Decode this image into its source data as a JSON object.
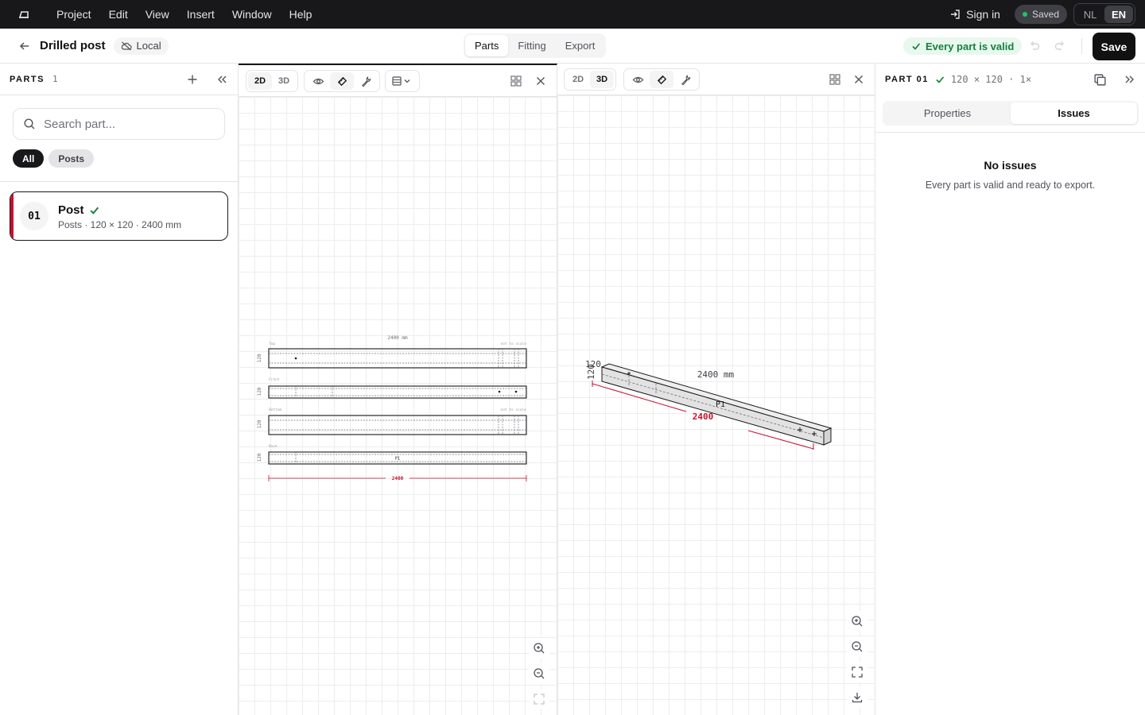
{
  "menubar": {
    "items": [
      "Project",
      "Edit",
      "View",
      "Insert",
      "Window",
      "Help"
    ],
    "sign_in": "Sign in",
    "saved": "Saved",
    "saved_color": "#22c55e",
    "languages": [
      "NL",
      "EN"
    ],
    "active_language": "EN"
  },
  "header": {
    "title": "Drilled post",
    "storage": "Local",
    "modes": [
      "Parts",
      "Fitting",
      "Export"
    ],
    "active_mode": "Parts",
    "status": "Every part is valid",
    "save": "Save"
  },
  "sidebar": {
    "title": "PARTS",
    "count": "1",
    "search_placeholder": "Search part...",
    "filters": [
      "All",
      "Posts"
    ],
    "active_filter": "All",
    "parts": [
      {
        "number": "01",
        "name": "Post",
        "meta": "Posts · 120 × 120 · 2400 mm",
        "valid": true,
        "color": "#c8102e"
      }
    ]
  },
  "view2d": {
    "modes": [
      "2D",
      "3D"
    ],
    "active": "2D",
    "length_label": "2400 mm",
    "dim_total": "2400",
    "thickness": "120",
    "views": [
      {
        "name": "Top",
        "note": "not to scale"
      },
      {
        "name": "Front",
        "note": ""
      },
      {
        "name": "Bottom",
        "note": "not to scale"
      },
      {
        "name": "Back",
        "note": ""
      }
    ],
    "part_label": "P1"
  },
  "view3d": {
    "modes": [
      "2D",
      "3D"
    ],
    "active": "3D",
    "length_label": "2400 mm",
    "dim_total": "2400",
    "thickness_a": "120",
    "thickness_b": "120",
    "part_label": "P1"
  },
  "rpanel": {
    "title": "PART 01",
    "dims": "120 × 120 · 1×",
    "tabs": [
      "Properties",
      "Issues"
    ],
    "active_tab": "Issues",
    "empty_title": "No issues",
    "empty_subtitle": "Every part is valid and ready to export."
  },
  "colors": {
    "accent": "#18181b",
    "valid": "#15803d",
    "dimension": "#c8102e"
  }
}
